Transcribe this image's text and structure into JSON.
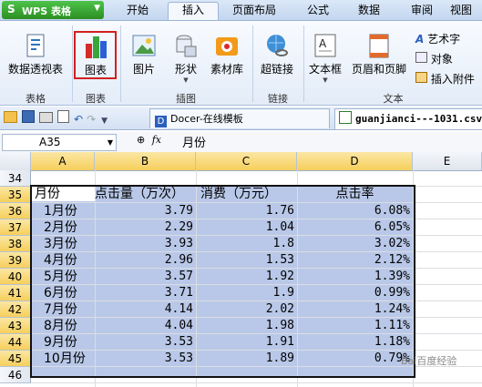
{
  "app": {
    "title": "WPS 表格",
    "logo": "S"
  },
  "menu": {
    "tabs": [
      "开始",
      "插入",
      "页面布局",
      "公式",
      "数据",
      "审阅",
      "视图"
    ],
    "active": "插入"
  },
  "ribbon": {
    "buttons": [
      "数据透视表",
      "图表",
      "图片",
      "形状",
      "素材库",
      "超链接",
      "文本框",
      "页眉和页脚"
    ],
    "small": [
      "艺术字",
      "对象",
      "插入附件"
    ],
    "groups": [
      "表格",
      "图表",
      "插图",
      "链接",
      "文本"
    ]
  },
  "doctabs": {
    "tab1": "Docer-在线模板",
    "tab2": "guanjianci---1031.csv"
  },
  "formula": {
    "namebox": "A35",
    "fx": "fx",
    "value": "月份"
  },
  "columns": [
    "A",
    "B",
    "C",
    "D",
    "E"
  ],
  "rows": [
    "34",
    "35",
    "36",
    "37",
    "38",
    "39",
    "40",
    "41",
    "42",
    "43",
    "44",
    "45",
    "46"
  ],
  "table": {
    "headers": [
      "月份",
      "点击量（万次）",
      "消费（万元）",
      "点击率"
    ],
    "data": [
      [
        "1月份",
        "3.79",
        "1.76",
        "6.08%"
      ],
      [
        "2月份",
        "2.29",
        "1.04",
        "6.05%"
      ],
      [
        "3月份",
        "3.93",
        "1.8",
        "3.02%"
      ],
      [
        "4月份",
        "2.96",
        "1.53",
        "2.12%"
      ],
      [
        "5月份",
        "3.57",
        "1.92",
        "1.39%"
      ],
      [
        "6月份",
        "3.71",
        "1.9",
        "0.99%"
      ],
      [
        "7月份",
        "4.14",
        "2.02",
        "1.24%"
      ],
      [
        "8月份",
        "4.04",
        "1.98",
        "1.11%"
      ],
      [
        "9月份",
        "3.53",
        "1.91",
        "1.18%"
      ],
      [
        "10月份",
        "3.53",
        "1.89",
        "0.79%"
      ]
    ]
  },
  "colors": {
    "selection": "#b9c8e8",
    "highlight_border": "#d22020",
    "header_selected": "#f6cf5c"
  }
}
